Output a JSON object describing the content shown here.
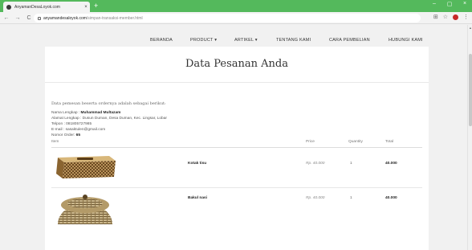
{
  "browser": {
    "tab_title": "AnyamanDesaLoyok.com",
    "tab_close": "×",
    "new_tab": "+",
    "back": "←",
    "forward": "→",
    "reload": "C",
    "url_host": "anyamandesaloyok.com",
    "url_path": "/simpan-transaksi-member.html",
    "minimize": "–",
    "maximize": "▢",
    "close": "×",
    "translate": "⊞",
    "star": "☆",
    "menu": "⋮"
  },
  "nav": {
    "items": [
      "BERANDA",
      "PRODUCT ▾",
      "ARTIKEL ▾",
      "TENTANG KAMI",
      "CARA PEMBELIAN",
      "HUBUNGI KAMI"
    ]
  },
  "page": {
    "title": "Data Pesanan Anda",
    "intro": "Data pemesan beserta ordernya adalah sebagai berikut:",
    "info": {
      "name_label": "Nama Lengkap : ",
      "name_value": "Muhammad Multazam",
      "address": "Alamat Lengkap : Dusun Duman, Desa Duman, Kec. Lingsar, Lobar",
      "phone": "Telpon : 081805727985",
      "email": "E-mail : sasaktulen@gmail.com",
      "order_label": "Nomor Order: ",
      "order_value": "65"
    },
    "table": {
      "headers": {
        "item": "Item",
        "price": "Price",
        "quantity": "Quantity",
        "total": "Total"
      },
      "rows": [
        {
          "name": "Kotak tisu",
          "price": "Rp. 40.000",
          "quantity": "1",
          "total": "40.000"
        },
        {
          "name": "Bakul nasi",
          "price": "Rp. 40.000",
          "quantity": "1",
          "total": "40.000"
        }
      ]
    }
  },
  "colors": {
    "chrome_green": "#54b95c",
    "tab_bg": "#f3f3f3",
    "card_bg": "#ffffff",
    "page_bg": "#f1f1f1"
  }
}
